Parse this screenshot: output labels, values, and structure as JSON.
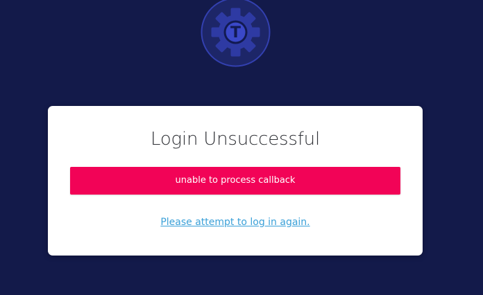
{
  "colors": {
    "background": "#131a4a",
    "card": "#ffffff",
    "error": "#f20357",
    "link": "#3aa0d8",
    "logo_fill": "#2e3aa3",
    "logo_ring": "#3340b0"
  },
  "logo": {
    "icon": "gear-t-icon",
    "letter": "T"
  },
  "card": {
    "title": "Login Unsuccessful",
    "error_message": "unable to process callback",
    "retry_link": "Please attempt to log in again."
  }
}
